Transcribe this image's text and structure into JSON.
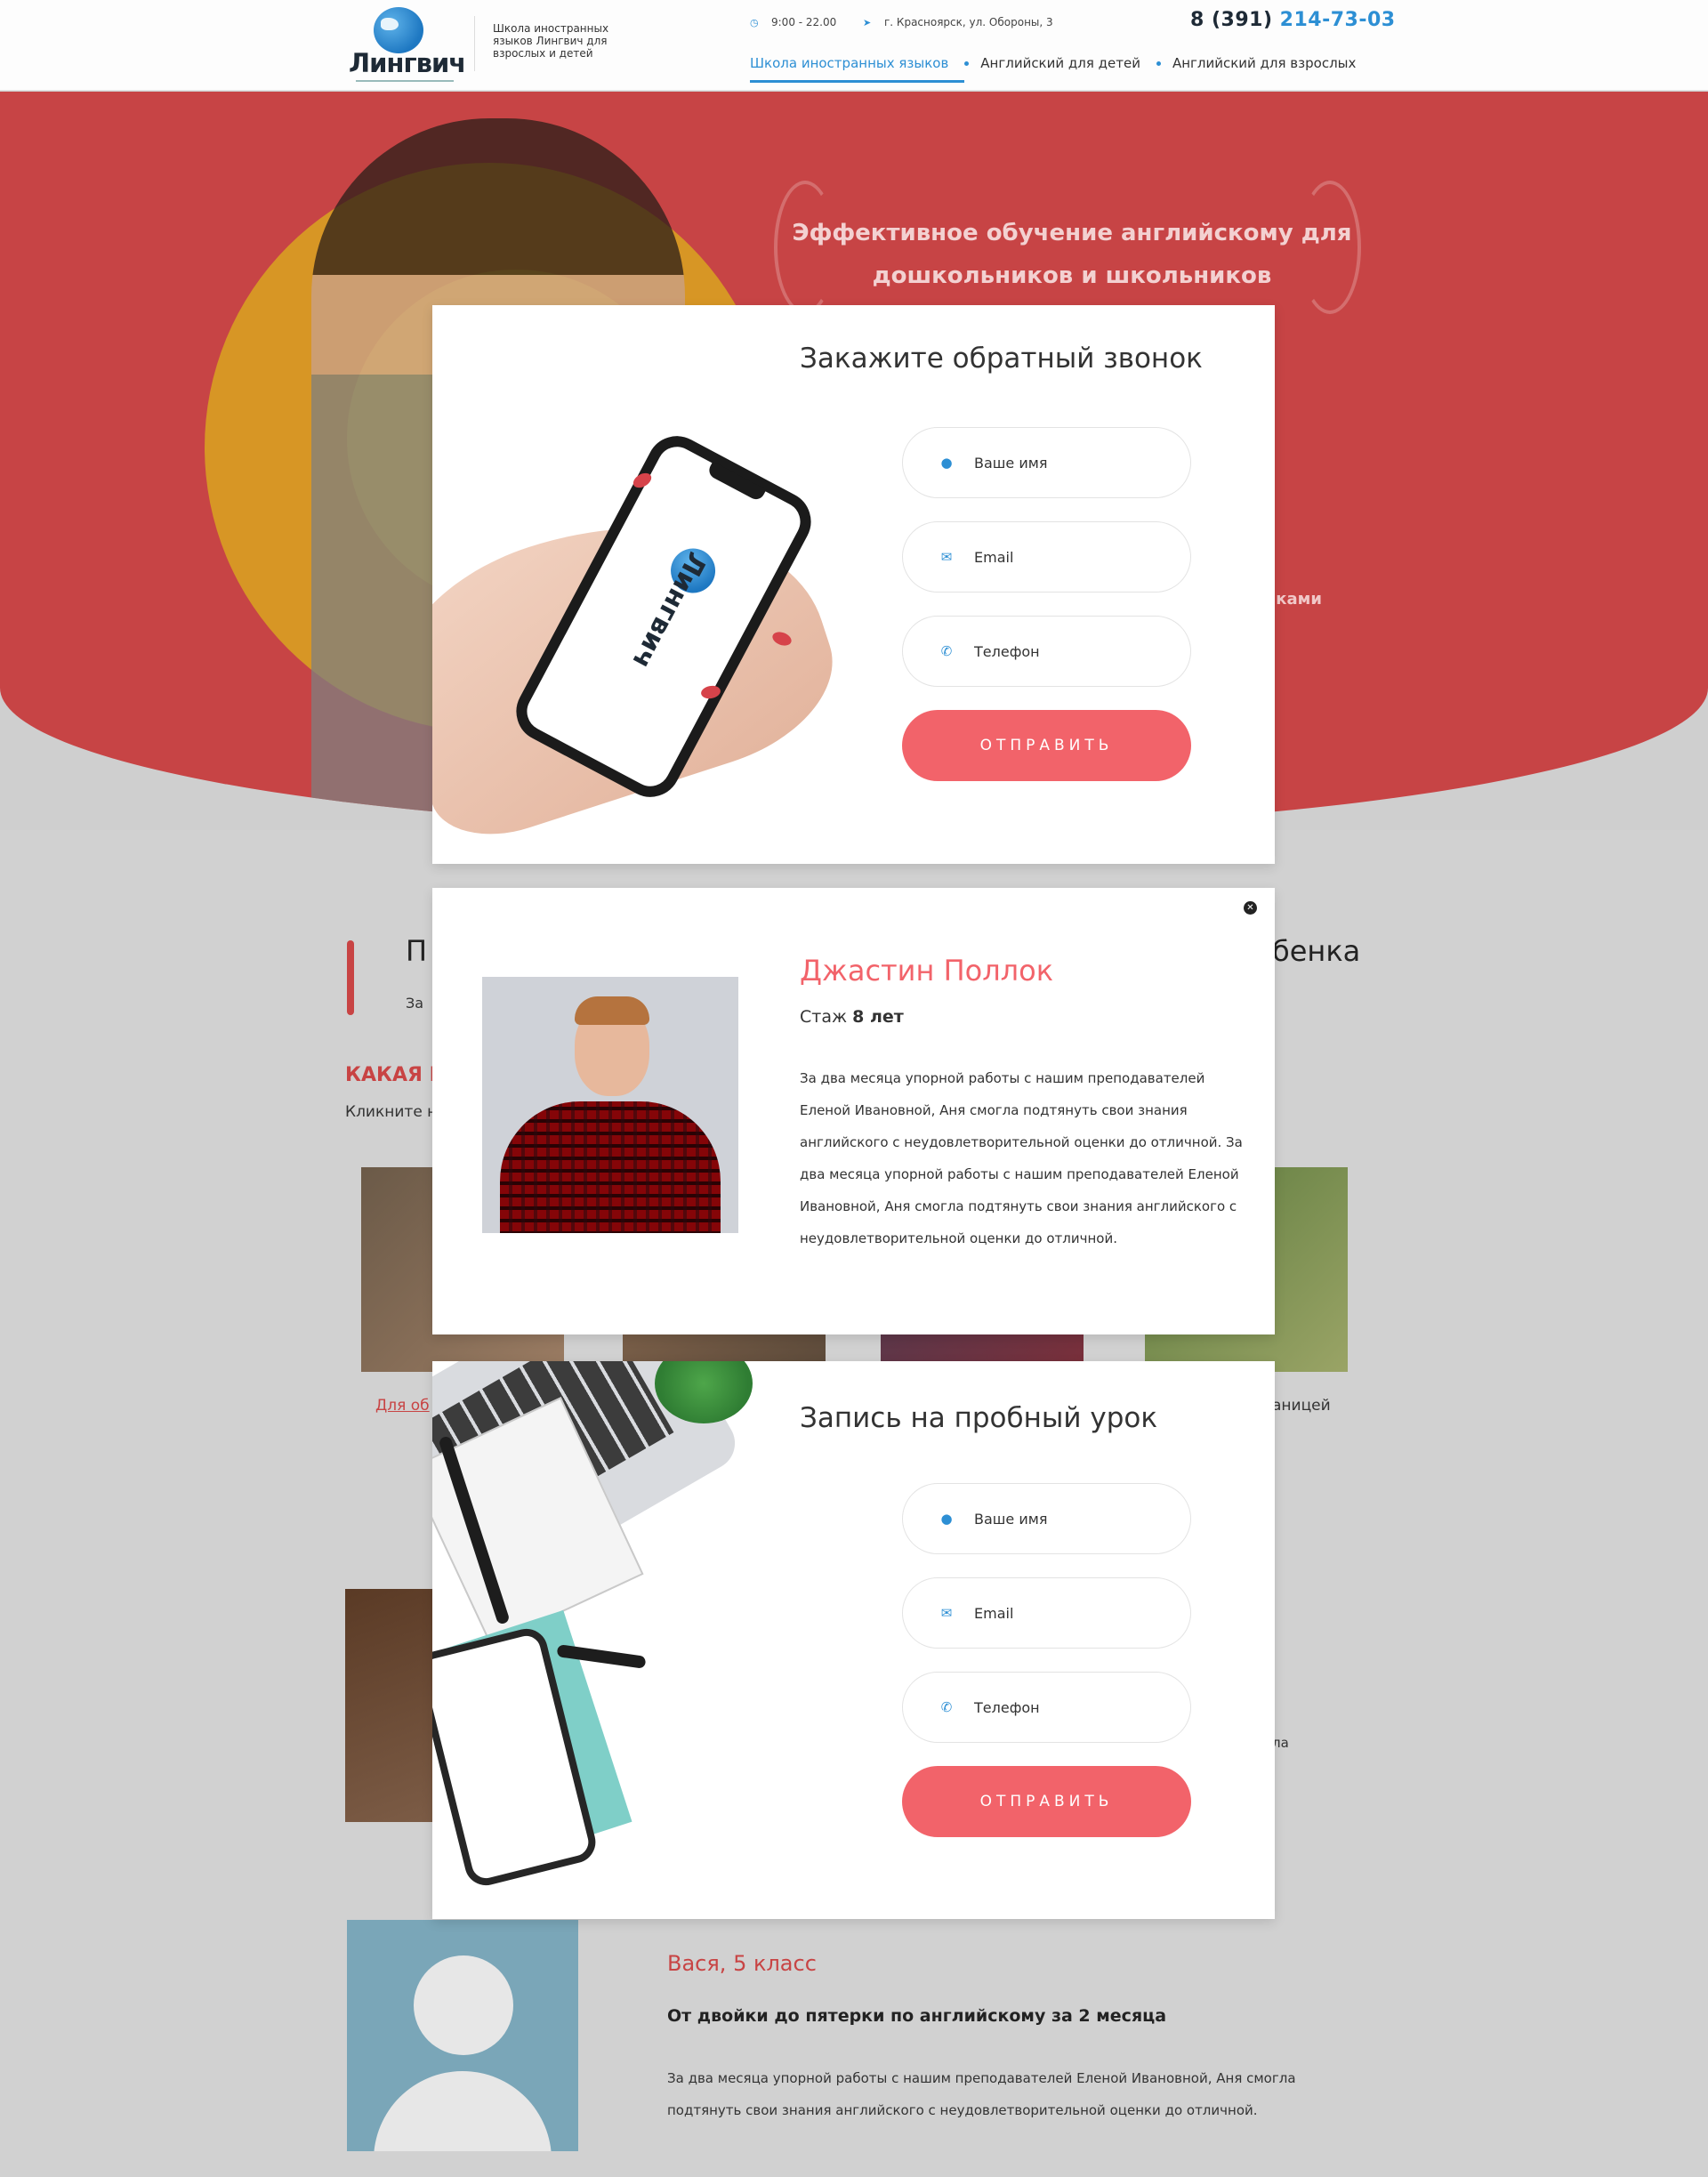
{
  "header": {
    "logo_text": "Лингвич",
    "tagline": "Школа иностранных языков Лингвич для взрослых и детей",
    "hours": "9:00 - 22.00",
    "address": "г. Красноярск, ул. Обороны, 3",
    "phone_prefix": "8 (391)",
    "phone_number": "214-73-03",
    "nav": [
      {
        "label": "Школа иностранных языков",
        "active": true
      },
      {
        "label": "Английский для детей"
      },
      {
        "label": "Английский для взрослых"
      }
    ]
  },
  "hero": {
    "title": "Эффективное обучение английскому для дошкольников и школьников",
    "right_fragment": "ыками"
  },
  "background_fragments": {
    "section_title_left": "П",
    "section_title_right": "бенка",
    "section_sub": "За",
    "kak": "КАКАЯ Ш",
    "klik": "Кликните н",
    "card_link": "Для об",
    "card_text": "аницей",
    "la": "ла"
  },
  "review": {
    "name": "Вася, 5 класс",
    "headline": "От двойки до пятерки по английскому за 2 месяца",
    "text": "За два месяца упорной работы с нашим преподавателей Еленой Ивановной, Аня смогла подтянуть свои знания английского с неудовлетворительной оценки до отличной."
  },
  "callback_modal": {
    "title": "Закажите обратный звонок",
    "name_placeholder": "Ваше имя",
    "email_placeholder": "Email",
    "phone_placeholder": "Телефон",
    "submit": "ОТПРАВИТЬ",
    "phone_logo": "Лингвич"
  },
  "teacher_modal": {
    "name": "Джастин Поллок",
    "exp_label": "Стаж",
    "exp_value": "8 лет",
    "bio": "За два месяца упорной работы с нашим преподавателей Еленой Ивановной, Аня смогла подтянуть свои знания английского с неудовлетворительной оценки до отличной. За два месяца упорной работы с нашим преподавателей Еленой Ивановной, Аня смогла подтянуть свои знания английского с неудовлетворительной оценки до отличной."
  },
  "trial_modal": {
    "title": "Запись на пробный урок",
    "name_placeholder": "Ваше имя",
    "email_placeholder": "Email",
    "phone_placeholder": "Телефон",
    "submit": "ОТПРАВИТЬ"
  },
  "icons": {
    "user": "user-icon",
    "email": "envelope-icon",
    "phone": "phone-icon",
    "clock": "clock-icon",
    "location": "location-arrow-icon",
    "close": "close-icon"
  },
  "colors": {
    "accent_blue": "#2d8fd4",
    "accent_coral": "#f2636a",
    "hero_red": "#c74445"
  }
}
